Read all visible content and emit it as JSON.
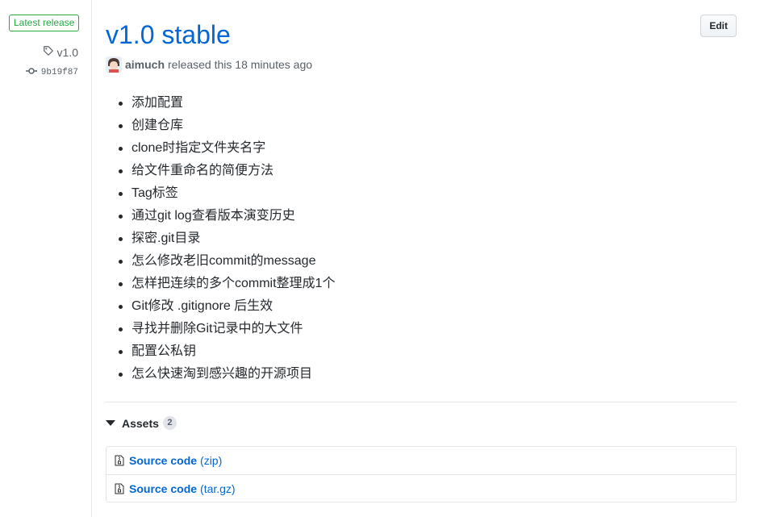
{
  "sidebar": {
    "badge": "Latest release",
    "tag": "v1.0",
    "commit": "9b19f87"
  },
  "release": {
    "title": "v1.0 stable",
    "edit_label": "Edit",
    "author": "aimuch",
    "released_text": "released this 18 minutes ago",
    "notes": [
      "添加配置",
      "创建仓库",
      "clone时指定文件夹名字",
      "给文件重命名的简便方法",
      "Tag标签",
      "通过git log查看版本演变历史",
      "探密.git目录",
      "怎么修改老旧commit的message",
      "怎样把连续的多个commit整理成1个",
      "Git修改 .gitignore 后生效",
      "寻找并删除Git记录中的大文件",
      "配置公私钥",
      "怎么快速淘到感兴趣的开源项目"
    ]
  },
  "assets": {
    "label": "Assets",
    "count": "2",
    "items": [
      {
        "name": "Source code",
        "ext": "(zip)"
      },
      {
        "name": "Source code",
        "ext": "(tar.gz)"
      }
    ]
  },
  "colors": {
    "link": "#0366d6",
    "latest_badge": "#28a745",
    "muted": "#586069"
  },
  "icons": [
    "tag-icon",
    "commit-icon",
    "zip-icon",
    "caret-down-icon"
  ]
}
